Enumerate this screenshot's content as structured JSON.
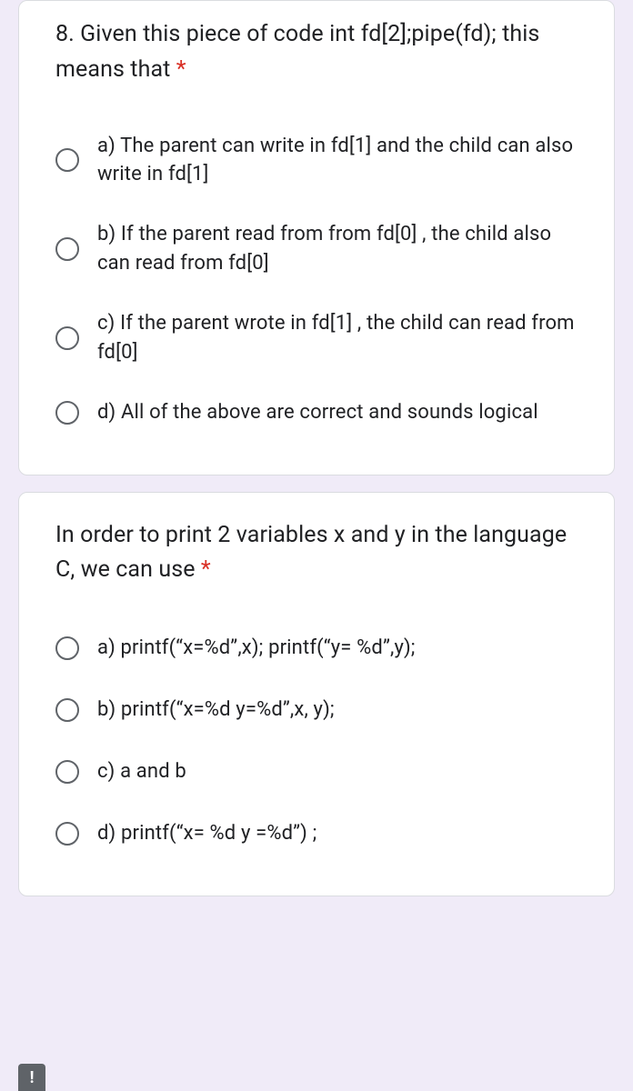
{
  "questions": [
    {
      "title": "8. Given this piece of code int fd[2];pipe(fd); this means that ",
      "required": "*",
      "options": [
        "a) The parent can write in fd[1] and the child can also write in fd[1]",
        "b) If the parent read from from fd[0] , the child also can read from fd[0]",
        "c) If the parent wrote in fd[1] , the child can read from fd[0]",
        "d) All of the above are correct and sounds logical"
      ]
    },
    {
      "title": "In order to print 2 variables x and y in the language C, we can use ",
      "required": "*",
      "options": [
        "a) printf(“x=%d”,x); printf(“y= %d”,y);",
        "b) printf(“x=%d y=%d”,x, y);",
        "c) a and b",
        "d) printf(“x= %d y =%d”) ;"
      ]
    }
  ],
  "report_icon": "!"
}
